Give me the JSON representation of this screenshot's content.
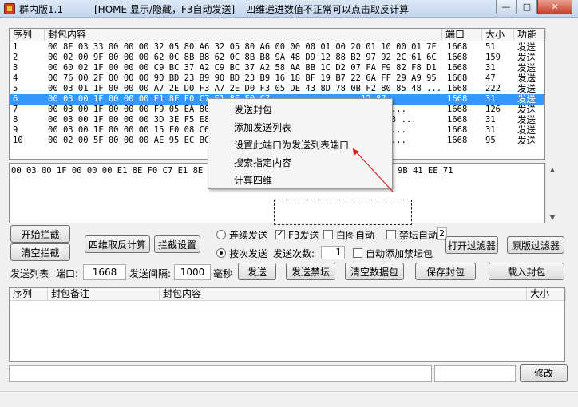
{
  "title_bar": {
    "app_name": "群内版1.1",
    "hint1": "[HOME 显示/隐藏，F3自动发送]",
    "hint2": "四维递进数值不正常可以点击取反计算",
    "minimize": "—",
    "maximize": "□",
    "close": "✕"
  },
  "packet_table": {
    "headers": {
      "seq": "序列",
      "content": "封包内容",
      "port": "端口",
      "size": "大小",
      "func": "功能"
    },
    "rows": [
      {
        "seq": "1",
        "content": "00 8F 03 33 00 00 00 32 05 80 A6 32 05 80 A6 00 00 00 01 00 20 01 10 00 01 7F ...",
        "port": "1668",
        "size": "51",
        "func": "发送"
      },
      {
        "seq": "2",
        "content": "00 02 00 9F 00 00 00 62 0C 8B B8 62 0C 8B B8 9A 48 D9 12 88 B2 97 92 2C 61 6C ...",
        "port": "1668",
        "size": "159",
        "func": "发送"
      },
      {
        "seq": "3",
        "content": "00 60 02 1F 00 00 00 C9 BC 37 A2 C9 BC 37 A2 58 AA BB 1C D2 07 FA F9 82 F8 D1 ...",
        "port": "1668",
        "size": "31",
        "func": "发送"
      },
      {
        "seq": "4",
        "content": "00 76 00 2F 00 00 00 90 BD 23 B9 90 BD 23 B9 16 18 BF 19 B7 22 6A FF 29 A9 95 ...",
        "port": "1668",
        "size": "47",
        "func": "发送"
      },
      {
        "seq": "5",
        "content": "00 03 01 1F 00 00 00 A7 2E D0 F3 A7 2E D0 F3 05 DE 43 8D 78 0B F2 80 85 48 ...",
        "port": "1668",
        "size": "222",
        "func": "发送"
      },
      {
        "seq": "6",
        "content": "00 03 00 1F 00 00 00 E1 8E F0 C7 E1 8E F0 C7 ",
        "tail": "12 87",
        "port": "1668",
        "size": "31",
        "func": "发送"
      },
      {
        "seq": "7",
        "content": "00 03 00 1F 00 00 00 F9 05 EA 80 ",
        "tail": "AC B8 ...",
        "port": "1668",
        "size": "126",
        "func": "发送"
      },
      {
        "seq": "8",
        "content": "00 03 00 1F 00 00 00 3D 3E F5 E8 ",
        "tail": "A1A A73 ...",
        "port": "1668",
        "size": "31",
        "func": "发送"
      },
      {
        "seq": "9",
        "content": "00 03 00 1F 00 00 00 15 F0 08 C6 ",
        "tail": "86 B0 ...",
        "port": "1668",
        "size": "31",
        "func": "发送"
      },
      {
        "seq": "10",
        "content": "00 02 00 5F 00 00 00 AE 95 EC BC ",
        "tail": "86 C4 ...",
        "port": "1668",
        "size": "95",
        "func": "发送"
      }
    ]
  },
  "hex_view": {
    "text": "00 03 00 1F 00 00 00 E1 8E F0 C7 E1 8E F0",
    "tail": "9B 41 EE 71"
  },
  "context_menu": {
    "items": [
      "发送封包",
      "添加发送列表",
      "设置此端口为发送列表端口",
      "搜索指定内容",
      "计算四维"
    ]
  },
  "controls": {
    "start_intercept": "开始拦截",
    "clear_intercept": "清空拦截",
    "reverse_calc": "四维取反计算",
    "intercept_settings": "拦截设置",
    "continuous_send": "连续发送",
    "f3_send": "F3发送",
    "auto_image": "白图自动",
    "forum_auto": "禁坛自动",
    "forum_auto_value": "2",
    "open_filter": "打开过滤器",
    "original_filter": "原版过滤器",
    "single_send": "按次发送",
    "send_count_label": "发送次数:",
    "send_count_value": "1",
    "auto_add_forum": "自动添加禁坛包",
    "send_list_label": "发送列表",
    "port_label": "端口:",
    "port_value": "1668",
    "interval_label": "发送间隔:",
    "interval_value": "1000",
    "ms_label": "毫秒",
    "send": "发送",
    "send_forum": "发送禁坛",
    "clear_packets": "清空数据包",
    "save_packet": "保存封包",
    "load_packet": "载入封包",
    "edit": "修改"
  },
  "send_list": {
    "headers": {
      "seq": "序列",
      "note": "封包备注",
      "content": "封包内容",
      "size": "大小"
    }
  },
  "colors": {
    "selection": "#3399ff",
    "annotation_arrow": "#e02020"
  }
}
